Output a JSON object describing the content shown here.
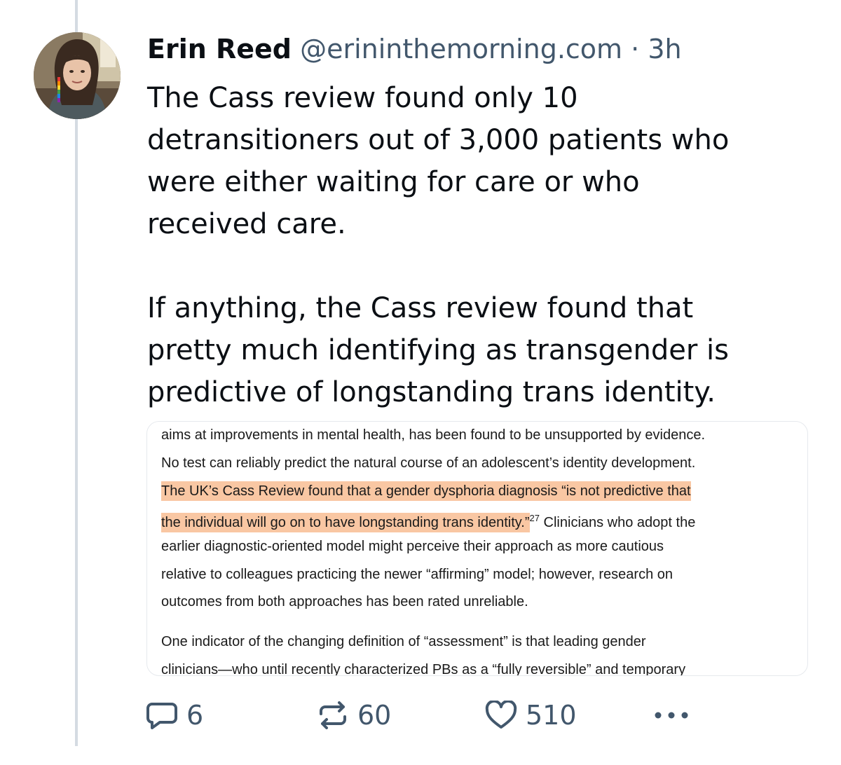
{
  "post": {
    "author_name": "Erin Reed",
    "author_handle": "@erininthemorning.com",
    "separator": "·",
    "timestamp": "3h",
    "paragraph_1": "The Cass review found only 10\ndetransitioners out of 3,000 patients who\nwere either waiting for care or who\nreceived care.",
    "paragraph_2": "If anything, the Cass review found that\npretty much identifying as transgender is\npredictive of longstanding trans identity."
  },
  "embed": {
    "line_0": "aims at improvements in mental health, has been found to be unsupported by evidence.",
    "line_1": "No test can reliably predict the natural course of an adolescent’s identity development.",
    "line_2": "The UK’s Cass Review found that a gender dysphoria diagnosis “is not predictive that",
    "line_3_highlight": "the individual will go on to have longstanding trans identity.”",
    "line_3_sup": "27",
    "line_3_rest": " Clinicians who adopt the",
    "line_4": "earlier diagnostic-oriented model might perceive their approach as more cautious",
    "line_5": "relative to colleagues practicing the newer “affirming” model; however, research on",
    "line_6": "outcomes from both approaches has been rated unreliable.",
    "line_7": "One indicator of the changing definition of “assessment” is that leading gender",
    "line_8": "clinicians—who until recently characterized PBs as a “fully reversible” and temporary",
    "highlight_color": "#f9c7a3"
  },
  "actions": {
    "reply_count": "6",
    "repost_count": "60",
    "like_count": "510",
    "reply_icon": "speech-bubble-icon",
    "repost_icon": "repost-arrows-icon",
    "like_icon": "heart-icon",
    "more_icon": "ellipsis-icon"
  },
  "colors": {
    "text_primary": "#0b0f14",
    "text_secondary": "#42576c",
    "thread_line": "#d4dbe2"
  }
}
